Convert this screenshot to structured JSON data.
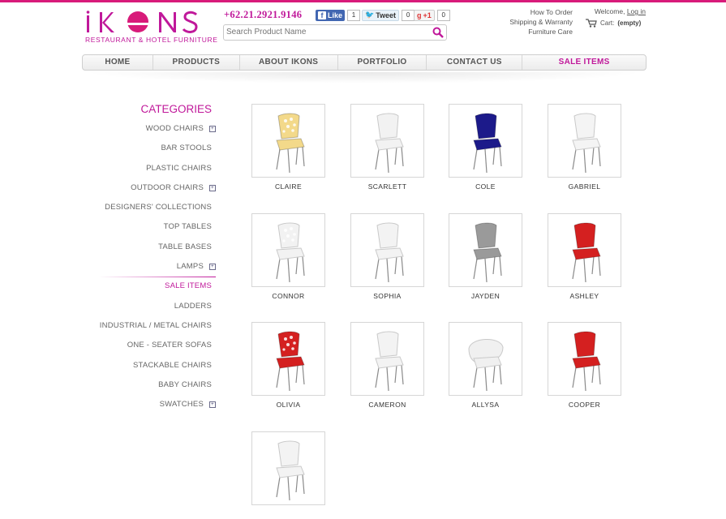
{
  "header": {
    "logo_text": "IKONS",
    "logo_subtitle": "RESTAURANT & HOTEL FURNITURE",
    "phone": "+62.21.2921.9146",
    "facebook": {
      "label": "Like",
      "count": "1"
    },
    "twitter": {
      "label": "Tweet",
      "count": "0"
    },
    "gplus": {
      "label": "+1",
      "count": "0"
    },
    "search_placeholder": "Search Product Name",
    "links": [
      "How To Order",
      "Shipping & Warranty",
      "Furniture Care"
    ],
    "welcome": "Welcome,",
    "login": "Log in",
    "cart_label": "Cart:",
    "cart_value": "(empty)"
  },
  "nav": [
    {
      "label": "HOME"
    },
    {
      "label": "PRODUCTS"
    },
    {
      "label": "ABOUT IKONS"
    },
    {
      "label": "PORTFOLIO"
    },
    {
      "label": "CONTACT US"
    },
    {
      "label": "SALE ITEMS"
    }
  ],
  "categories": {
    "title": "CATEGORIES",
    "items": [
      {
        "label": "WOOD CHAIRS",
        "expand": true
      },
      {
        "label": "BAR STOOLS",
        "expand": false
      },
      {
        "label": "PLASTIC CHAIRS",
        "expand": false
      },
      {
        "label": "OUTDOOR CHAIRS",
        "expand": true
      },
      {
        "label": "DESIGNERS' COLLECTIONS",
        "expand": false
      },
      {
        "label": "TOP TABLES",
        "expand": false
      },
      {
        "label": "TABLE BASES",
        "expand": false
      },
      {
        "label": "LAMPS",
        "expand": true
      },
      {
        "label": "SALE ITEMS",
        "expand": false,
        "active": true
      },
      {
        "label": "LADDERS",
        "expand": false
      },
      {
        "label": "INDUSTRIAL / METAL CHAIRS",
        "expand": false
      },
      {
        "label": "ONE - SEATER SOFAS",
        "expand": false
      },
      {
        "label": "STACKABLE CHAIRS",
        "expand": false
      },
      {
        "label": "BABY CHAIRS",
        "expand": false
      },
      {
        "label": "SWATCHES",
        "expand": true
      }
    ]
  },
  "products": [
    {
      "name": "CLAIRE",
      "color": "#f3d98a",
      "style": "lace"
    },
    {
      "name": "SCARLETT",
      "color": "#f2f2f2",
      "style": "solid"
    },
    {
      "name": "COLE",
      "color": "#1c1a8a",
      "style": "solid"
    },
    {
      "name": "GABRIEL",
      "color": "#f4f4f4",
      "style": "solid"
    },
    {
      "name": "CONNOR",
      "color": "#f2f2f2",
      "style": "lace"
    },
    {
      "name": "SOPHIA",
      "color": "#f3f3f3",
      "style": "solid"
    },
    {
      "name": "JAYDEN",
      "color": "#9a9a9a",
      "style": "solid"
    },
    {
      "name": "ASHLEY",
      "color": "#d42020",
      "style": "solid"
    },
    {
      "name": "OLIVIA",
      "color": "#d42020",
      "style": "lace"
    },
    {
      "name": "CAMERON",
      "color": "#f3f3f3",
      "style": "solid"
    },
    {
      "name": "ALLYSA",
      "color": "#f0f0f0",
      "style": "shell"
    },
    {
      "name": "COOPER",
      "color": "#d42020",
      "style": "solid"
    },
    {
      "name": "",
      "color": "#f3f3f3",
      "style": "solid"
    }
  ],
  "colors": {
    "brand": "#c0189a"
  }
}
